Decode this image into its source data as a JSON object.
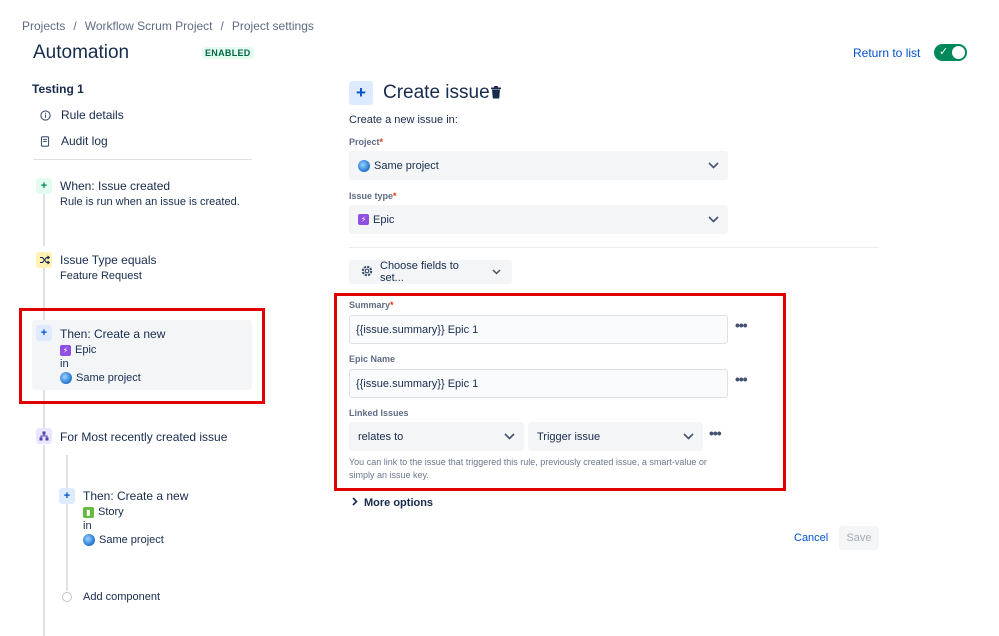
{
  "breadcrumb": {
    "items": [
      "Projects",
      "Workflow Scrum Project",
      "Project settings"
    ],
    "separator": "/"
  },
  "header": {
    "title": "Automation",
    "status": "ENABLED",
    "return_link": "Return to list"
  },
  "sidebar": {
    "rule_name": "Testing 1",
    "links": [
      {
        "label": "Rule details",
        "icon": "info-icon"
      },
      {
        "label": "Audit log",
        "icon": "document-icon"
      }
    ],
    "components": {
      "trigger": {
        "title": "When: Issue created",
        "subtitle": "Rule is run when an issue is created."
      },
      "condition": {
        "title": "Issue Type equals",
        "subtitle": "Feature Request"
      },
      "action1": {
        "title": "Then: Create a new",
        "type": "Epic",
        "in": "in",
        "project": "Same project"
      },
      "branch": {
        "title": "For Most recently created issue"
      },
      "action2": {
        "title": "Then: Create a new",
        "type": "Story",
        "in": "in",
        "project": "Same project"
      },
      "add": {
        "label": "Add component"
      }
    }
  },
  "panel": {
    "title": "Create issue",
    "intro": "Create a new issue in:",
    "project": {
      "label": "Project",
      "required_mark": "*",
      "value": "Same project"
    },
    "issue_type": {
      "label": "Issue type",
      "required_mark": "*",
      "value": "Epic"
    },
    "choose_fields": "Choose fields to set...",
    "summary": {
      "label": "Summary",
      "required_mark": "*",
      "value": "{{issue.summary}} Epic 1"
    },
    "epic_name": {
      "label": "Epic Name",
      "value": "{{issue.summary}} Epic 1"
    },
    "linked_issues": {
      "label": "Linked Issues",
      "relation": "relates to",
      "target": "Trigger issue",
      "helper": "You can link to the issue that triggered this rule, previously created issue, a smart-value or simply an issue key."
    },
    "more_options": "More options",
    "cancel": "Cancel",
    "save": "Save"
  },
  "colors": {
    "accent": "#0052cc",
    "enabled_green": "#00875a",
    "highlight_red": "#e00000",
    "epic_purple": "#904ee2",
    "story_green": "#63ba3c"
  }
}
